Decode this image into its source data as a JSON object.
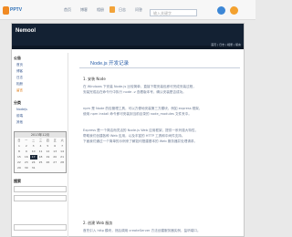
{
  "browser": {
    "logo_text": "PPTV",
    "nav_items": [
      "首页",
      "博客",
      "相册",
      "日志",
      "问答"
    ],
    "search_placeholder": "输入关键字",
    "colors": {
      "accent": "#2c6fb7",
      "logo": "#f08a23"
    }
  },
  "blog": {
    "title": "Nemool",
    "header_links": "首页 | 日志 | 相册 | 留言"
  },
  "sidebar": {
    "sections": [
      {
        "title": "公告",
        "links": [
          "首页",
          "博客",
          "日志",
          "相册",
          "留言"
        ]
      },
      {
        "title": "分类",
        "links": [
          "Nodejs",
          "前端",
          "其他"
        ]
      }
    ],
    "calendar": {
      "header": "2013年12月",
      "weekdays": [
        "日",
        "一",
        "二",
        "三",
        "四",
        "五",
        "六"
      ],
      "days": [
        "1",
        "2",
        "3",
        "4",
        "5",
        "6",
        "7",
        "8",
        "9",
        "10",
        "11",
        "12",
        "13",
        "14",
        "15",
        "16",
        "17",
        "18",
        "19",
        "20",
        "21",
        "22",
        "23",
        "24",
        "25",
        "26",
        "27",
        "28",
        "29",
        "30",
        "31"
      ],
      "highlight": "17"
    },
    "search_label": "搜索"
  },
  "post": {
    "title": "Node.js 开发记录",
    "sections": [
      {
        "heading": "1. 安装 Node",
        "lines": [
          "在 Windows 下安装 Node.js 比较简单，直接下载安装包即可完成安装过程，",
          "安装完成后在命令行中执行 node -v 查看版本号，确认安装是否成功。"
        ]
      },
      {
        "heading": "",
        "lines": [
          "npm 是 Node 的包管理工具，可以方便地安装第三方模块，例如 express 框架，",
          "使用 npm install 命令即可安装到当前目录的 node_modules 文件夹中。"
        ]
      },
      {
        "heading": "",
        "lines": [
          "Express 是一个简洁而灵活的 Node.js Web 应用框架，提供一系列强大特性，",
          "帮助我们创建各种 Web 应用，以及丰富的 HTTP 工具和中间件支持。",
          "下面我们通过一个简单的示例来了解如何搭建基本的 Web 服务器并处理请求。"
        ]
      },
      {
        "heading": "2. 创建 Web 服务",
        "lines": [
          "首先引入 http 模块，然后调用 createServer 方法创建服务器实例，监听端口。",
          "浏览器访问对应端口即可看到返回的内容，这样一个最简单的服务就完成了。"
        ]
      }
    ]
  }
}
